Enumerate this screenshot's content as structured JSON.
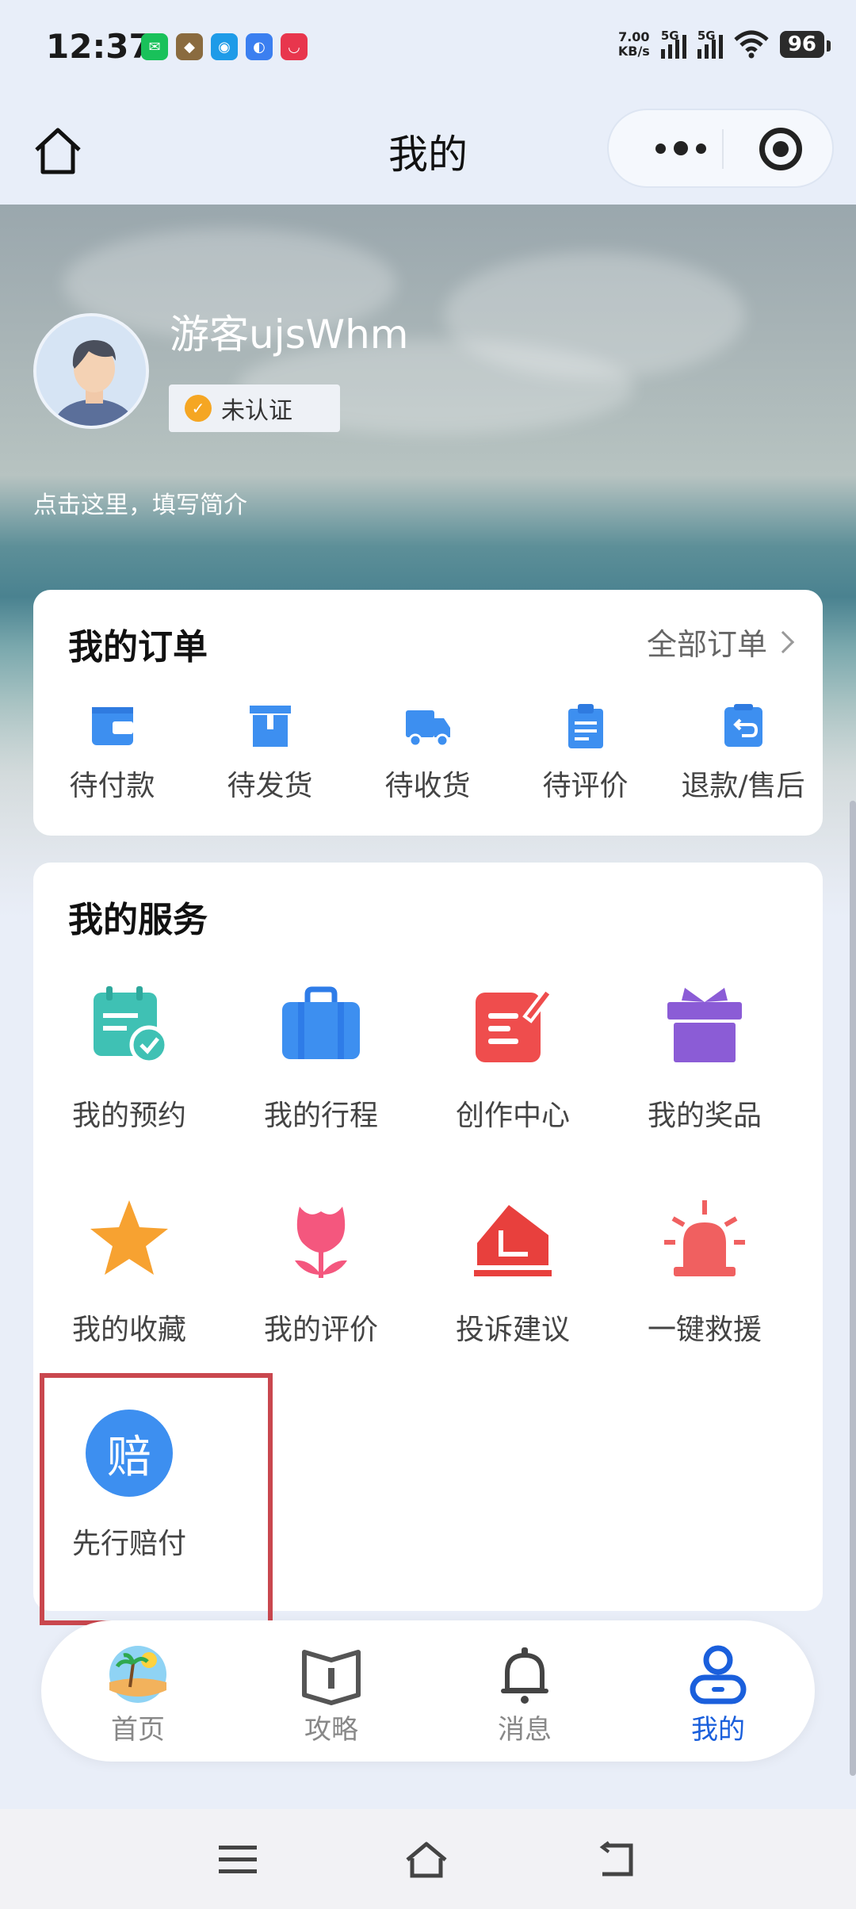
{
  "status_bar": {
    "time": "12:37",
    "net_speed_value": "7.00",
    "net_speed_unit": "KB/s",
    "signal1_label": "5G",
    "signal2_label": "5G",
    "battery": "96"
  },
  "header": {
    "title": "我的"
  },
  "profile": {
    "username": "游客ujsWhm",
    "cert_status": "未认证",
    "bio_placeholder": "点击这里，填写简介"
  },
  "orders": {
    "title": "我的订单",
    "all_label": "全部订单",
    "items": [
      {
        "label": "待付款",
        "icon": "wallet-icon"
      },
      {
        "label": "待发货",
        "icon": "box-icon"
      },
      {
        "label": "待收货",
        "icon": "truck-icon"
      },
      {
        "label": "待评价",
        "icon": "clipboard-icon"
      },
      {
        "label": "退款/售后",
        "icon": "refund-icon"
      }
    ]
  },
  "services": {
    "title": "我的服务",
    "items": [
      {
        "label": "我的预约",
        "icon": "calendar-check-icon"
      },
      {
        "label": "我的行程",
        "icon": "suitcase-icon"
      },
      {
        "label": "创作中心",
        "icon": "edit-note-icon"
      },
      {
        "label": "我的奖品",
        "icon": "gift-icon"
      },
      {
        "label": "我的收藏",
        "icon": "star-icon"
      },
      {
        "label": "我的评价",
        "icon": "tulip-icon"
      },
      {
        "label": "投诉建议",
        "icon": "envelope-icon"
      },
      {
        "label": "一键救援",
        "icon": "alarm-light-icon"
      },
      {
        "label": "先行赔付",
        "icon": "compensation-icon",
        "glyph": "赔"
      }
    ]
  },
  "tabs": [
    {
      "label": "首页",
      "icon": "beach-icon"
    },
    {
      "label": "攻略",
      "icon": "book-icon"
    },
    {
      "label": "消息",
      "icon": "bell-icon"
    },
    {
      "label": "我的",
      "icon": "person-icon",
      "active": true
    }
  ],
  "colors": {
    "accent": "#1a5fdc",
    "highlight": "#c9474e",
    "order_icon": "#3d8ff0"
  }
}
